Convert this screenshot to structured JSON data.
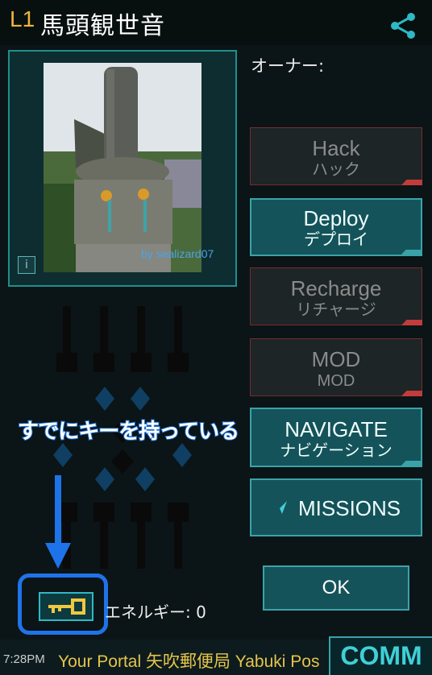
{
  "header": {
    "level": "L1",
    "portal_name": "馬頭観世音"
  },
  "photo": {
    "credit": "by sealizard07",
    "info_glyph": "i"
  },
  "owner_label": "オーナー:",
  "actions": [
    {
      "label": "Hack",
      "sublabel": "ハック",
      "state": "disabled"
    },
    {
      "label": "Deploy",
      "sublabel": "デプロイ",
      "state": "active"
    },
    {
      "label": "Recharge",
      "sublabel": "リチャージ",
      "state": "disabled"
    },
    {
      "label": "MOD",
      "sublabel": "MOD",
      "state": "disabled"
    },
    {
      "label": "NAVIGATE",
      "sublabel": "ナビゲーション",
      "state": "active"
    }
  ],
  "missions_label": "MISSIONS",
  "ok_label": "OK",
  "annotation": "すでにキーを持っている",
  "energy_text": "エネルギー: 0",
  "bottom": {
    "time": "7:28PM",
    "ticker_label": "Your Portal",
    "ticker_text": "矢吹郵便局 Yabuki Pos",
    "comm_label": "COMM"
  },
  "colors": {
    "accent": "#3aa3a8",
    "level": "#f0b43a",
    "annotation": "#1f73d9"
  }
}
